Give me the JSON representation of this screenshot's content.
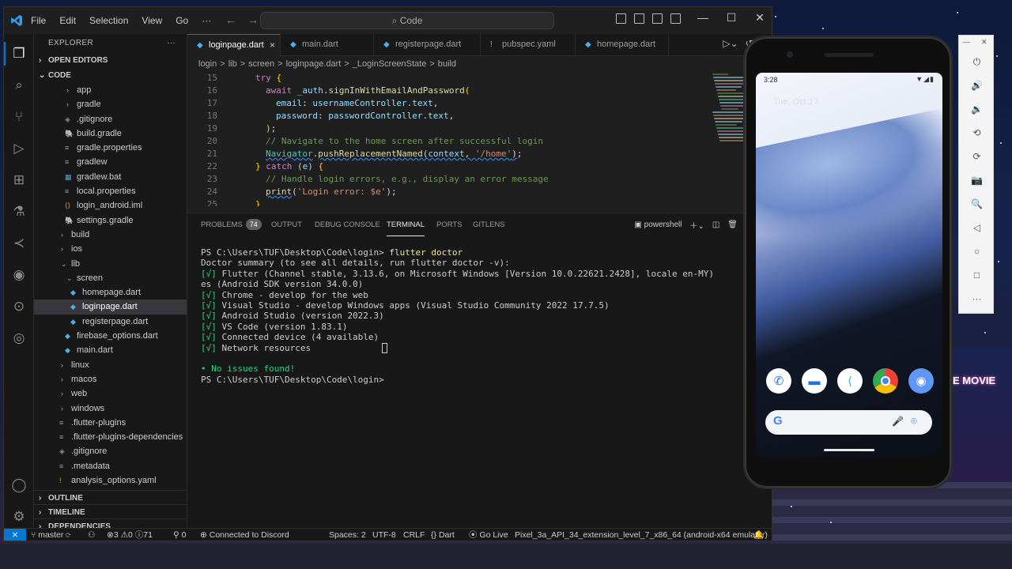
{
  "titlebar": {
    "menu": [
      "File",
      "Edit",
      "Selection",
      "View",
      "Go",
      "···"
    ],
    "command_center": "Code",
    "search_glyph": "⌕"
  },
  "explorer": {
    "title": "EXPLORER",
    "more": "···",
    "open_editors": "OPEN EDITORS",
    "root": "CODE",
    "items": [
      {
        "label": "app",
        "kind": "folder",
        "depth": 1
      },
      {
        "label": "gradle",
        "kind": "folder",
        "depth": 1
      },
      {
        "label": ".gitignore",
        "kind": "git",
        "depth": 1
      },
      {
        "label": "build.gradle",
        "kind": "gradle",
        "depth": 1
      },
      {
        "label": "gradle.properties",
        "kind": "prop",
        "depth": 1
      },
      {
        "label": "gradlew",
        "kind": "prop",
        "depth": 1
      },
      {
        "label": "gradlew.bat",
        "kind": "bat",
        "depth": 1
      },
      {
        "label": "local.properties",
        "kind": "prop",
        "depth": 1
      },
      {
        "label": "login_android.iml",
        "kind": "xml",
        "depth": 1
      },
      {
        "label": "settings.gradle",
        "kind": "gradle",
        "depth": 1
      },
      {
        "label": "build",
        "kind": "folder",
        "depth": 0
      },
      {
        "label": "ios",
        "kind": "folder",
        "depth": 0
      },
      {
        "label": "lib",
        "kind": "folder-open",
        "depth": 0
      },
      {
        "label": "screen",
        "kind": "folder-open",
        "depth": 1
      },
      {
        "label": "homepage.dart",
        "kind": "dart",
        "depth": 2
      },
      {
        "label": "loginpage.dart",
        "kind": "dart",
        "depth": 2,
        "selected": true
      },
      {
        "label": "registerpage.dart",
        "kind": "dart",
        "depth": 2
      },
      {
        "label": "firebase_options.dart",
        "kind": "dart",
        "depth": 1
      },
      {
        "label": "main.dart",
        "kind": "dart",
        "depth": 1
      },
      {
        "label": "linux",
        "kind": "folder",
        "depth": 0
      },
      {
        "label": "macos",
        "kind": "folder",
        "depth": 0
      },
      {
        "label": "web",
        "kind": "folder",
        "depth": 0
      },
      {
        "label": "windows",
        "kind": "folder",
        "depth": 0
      },
      {
        "label": ".flutter-plugins",
        "kind": "prop",
        "depth": 0
      },
      {
        "label": ".flutter-plugins-dependencies",
        "kind": "prop",
        "depth": 0
      },
      {
        "label": ".gitignore",
        "kind": "git",
        "depth": 0
      },
      {
        "label": ".metadata",
        "kind": "prop",
        "depth": 0
      },
      {
        "label": "analysis_options.yaml",
        "kind": "exclaim",
        "depth": 0
      }
    ],
    "outline": "OUTLINE",
    "timeline": "TIMELINE",
    "dependencies": "DEPENDENCIES"
  },
  "tabs": [
    {
      "label": "loginpage.dart",
      "active": true,
      "icon": "dart",
      "close": "×"
    },
    {
      "label": "main.dart",
      "icon": "dart"
    },
    {
      "label": "registerpage.dart",
      "icon": "dart"
    },
    {
      "label": "pubspec.yaml",
      "icon": "exclaim"
    },
    {
      "label": "homepage.dart",
      "icon": "dart"
    }
  ],
  "breadcrumb": [
    "login",
    ">",
    "lib",
    ">",
    "screen",
    ">",
    "loginpage.dart",
    ">",
    "_LoginScreenState",
    ">",
    "build"
  ],
  "code_lines": [
    {
      "n": "15",
      "html": "<span class='kw'>try</span> <span class='pun'>{</span>",
      "indent": 0
    },
    {
      "n": "16",
      "html": "<span class='kw'>await</span> <span class='var'>_auth</span>.<span class='fn'>signInWithEmailAndPassword</span><span class='pun'>(</span>",
      "indent": 1
    },
    {
      "n": "17",
      "html": "<span class='var'>email</span>: <span class='var'>usernameController</span>.<span class='var'>text</span>,",
      "indent": 2
    },
    {
      "n": "18",
      "html": "<span class='var'>password</span>: <span class='var'>passwordController</span>.<span class='var'>text</span>,",
      "indent": 2
    },
    {
      "n": "19",
      "html": "<span class='pun'>)</span>;",
      "indent": 1
    },
    {
      "n": "20",
      "html": "<span class='cmt'>// Navigate to the home screen after successful login</span>",
      "indent": 1
    },
    {
      "n": "21",
      "html": "<span class='typ squig'>Navigator</span>.<span class='fn squig'>pushReplacementNamed</span><span class='squig'>(<span class='var'>context</span>, <span class='str'>'/home'</span>)</span>;",
      "indent": 1
    },
    {
      "n": "22",
      "html": "<span class='pun'>}</span> <span class='kw'>catch</span> (<span class='var'>e</span>) <span class='pun'>{</span>",
      "indent": 0
    },
    {
      "n": "23",
      "html": "<span class='cmt'>// Handle login errors, e.g., display an error message</span>",
      "indent": 1
    },
    {
      "n": "24",
      "html": "<span class='fn squig'>print</span>(<span class='str'>'Login error: $e'</span>);",
      "indent": 1
    },
    {
      "n": "25",
      "html": "<span class='pun'>}</span>",
      "indent": 0
    }
  ],
  "panel": {
    "tabs": [
      "PROBLEMS",
      "OUTPUT",
      "DEBUG CONSOLE",
      "TERMINAL",
      "PORTS",
      "GITLENS"
    ],
    "problems_count": "74",
    "active_tab": "TERMINAL",
    "shell": "powershell"
  },
  "terminal": {
    "prompt": "PS C:\\Users\\TUF\\Desktop\\Code\\login>",
    "command": "flutter doctor",
    "lines": [
      {
        "mark": "",
        "text": "Doctor summary (to see all details, run flutter doctor -v):"
      },
      {
        "mark": "[√]",
        "text": " Flutter (Channel stable, 3.13.6, on Microsoft Windows [Version 10.0.22621.2428], locale en-MY)"
      },
      {
        "mark": "",
        "text": "es (Android SDK version 34.0.0)"
      },
      {
        "mark": "[√]",
        "text": " Chrome - develop for the web"
      },
      {
        "mark": "[√]",
        "text": " Visual Studio - develop Windows apps (Visual Studio Community 2022 17.7.5)"
      },
      {
        "mark": "[√]",
        "text": " Android Studio (version 2022.3)"
      },
      {
        "mark": "[√]",
        "text": " VS Code (version 1.83.1)"
      },
      {
        "mark": "[√]",
        "text": " Connected device (4 available)"
      },
      {
        "mark": "[√]",
        "text": " Network resources"
      }
    ],
    "summary": "• No issues found!",
    "final_prompt": "PS C:\\Users\\TUF\\Desktop\\Code\\login>"
  },
  "statusbar": {
    "remote": "⨯",
    "branch": "master",
    "errors": "3",
    "warnings": "0",
    "infos": "71",
    "ports": "0",
    "discord": "Connected to Discord",
    "spaces": "Spaces: 2",
    "encoding": "UTF-8",
    "eol": "CRLF",
    "language": "Dart",
    "golive": "Go Live",
    "device": "Pixel_3a_API_34_extension_level_7_x86_64 (android-x64 emulator)"
  },
  "phone": {
    "time": "3:28",
    "date": "Tue, Oct 17",
    "search_logo": "G"
  },
  "wallpaper": {
    "neon_text": "E MOVIE"
  }
}
